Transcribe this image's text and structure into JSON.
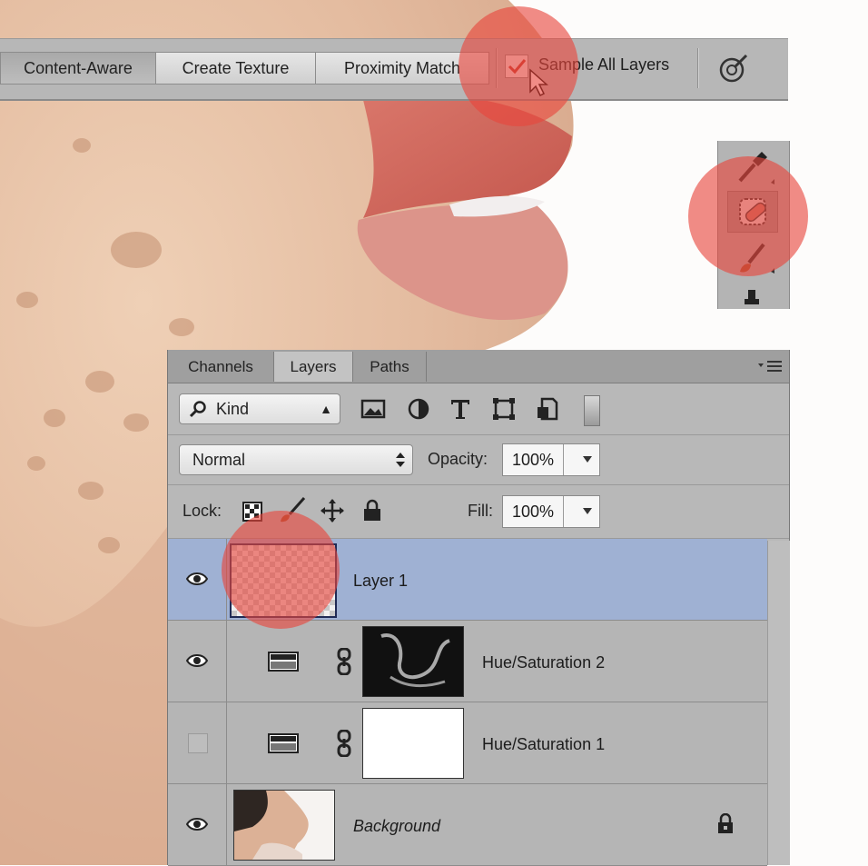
{
  "options_bar": {
    "buttons": [
      "Content-Aware",
      "Create Texture",
      "Proximity Match"
    ],
    "selected_button": "Content-Aware",
    "sample_all_layers_label": "Sample All Layers",
    "sample_all_layers_checked": true
  },
  "tools": [
    "eyedropper-tool",
    "spot-healing-brush-tool",
    "brush-tool",
    "clone-stamp-tool"
  ],
  "layers_panel": {
    "tabs": [
      "Channels",
      "Layers",
      "Paths"
    ],
    "active_tab": "Layers",
    "filter_kind": "Kind",
    "blend_mode": "Normal",
    "lock_label": "Lock:",
    "opacity_label": "Opacity:",
    "opacity_value": "100%",
    "fill_label": "Fill:",
    "fill_value": "100%",
    "layers": [
      {
        "name": "Layer 1",
        "visible": true,
        "selected": true
      },
      {
        "name": "Hue/Saturation 2",
        "visible": true,
        "selected": false
      },
      {
        "name": "Hue/Saturation 1",
        "visible": false,
        "selected": false
      },
      {
        "name": "Background",
        "visible": true,
        "selected": false,
        "locked": true
      }
    ]
  },
  "colors": {
    "highlight": "#e8463c",
    "selected_layer": "#9fb1d3",
    "panel": "#b8b8b8"
  }
}
